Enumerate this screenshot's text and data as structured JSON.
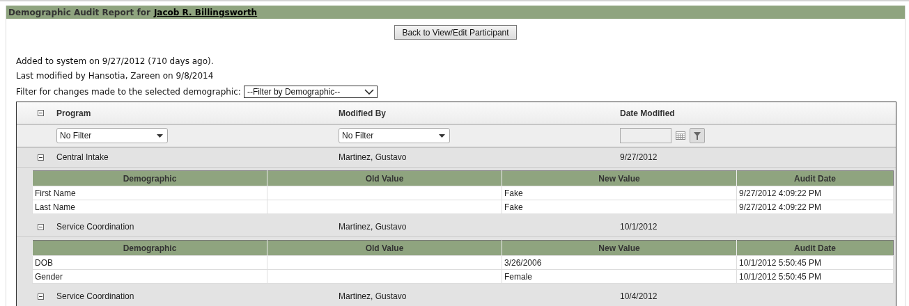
{
  "title": {
    "prefix": "Demographic Audit Report for",
    "participant": "Jacob R. Billingsworth"
  },
  "back_button": "Back to View/Edit Participant",
  "info_lines": [
    "Added to system on 9/27/2012 (710 days ago).",
    "Last modified by Hansotia, Zareen on 9/8/2014"
  ],
  "demographic_filter": {
    "label": "Filter for changes made to the selected demographic:",
    "value": "--Filter by Demographic--"
  },
  "grid": {
    "expanded": true,
    "columns": [
      "Program",
      "Modified By",
      "Date Modified"
    ],
    "filters": {
      "program": "No Filter",
      "modified_by": "No Filter"
    },
    "groups": [
      {
        "program": "Central Intake",
        "modified_by": "Martinez, Gustavo",
        "date": "9/27/2012",
        "expanded": true,
        "detail_columns": [
          "Demographic",
          "Old Value",
          "New Value",
          "Audit Date"
        ],
        "changes": [
          {
            "demographic": "First Name",
            "new_value": "Fake",
            "audit_date": "9/27/2012 4:09:22 PM"
          },
          {
            "demographic": "Last Name",
            "new_value": "Fake",
            "audit_date": "9/27/2012 4:09:22 PM"
          }
        ]
      },
      {
        "program": "Service Coordination",
        "modified_by": "Martinez, Gustavo",
        "date": "10/1/2012",
        "expanded": true,
        "detail_columns": [
          "Demographic",
          "Old Value",
          "New Value",
          "Audit Date"
        ],
        "changes": [
          {
            "demographic": "DOB",
            "new_value": "3/26/2006",
            "audit_date": "10/1/2012 5:50:45 PM"
          },
          {
            "demographic": "Gender",
            "new_value": "Female",
            "audit_date": "10/1/2012 5:50:45 PM"
          }
        ]
      },
      {
        "program": "Service Coordination",
        "modified_by": "Martinez, Gustavo",
        "date": "10/4/2012",
        "expanded": true
      }
    ]
  }
}
